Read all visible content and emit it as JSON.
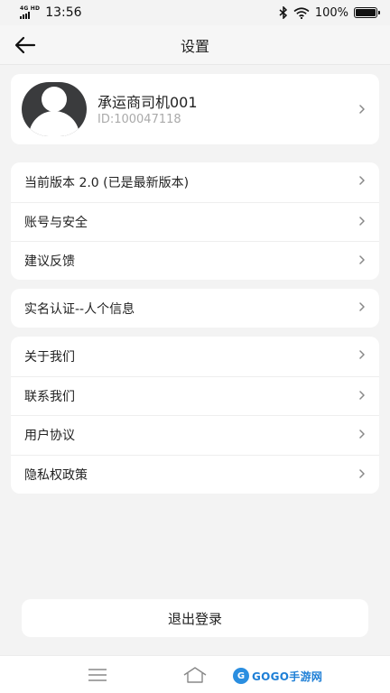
{
  "status_bar": {
    "network_type": "4G HD",
    "time": "13:56",
    "battery_percent": "100%",
    "battery_level": 1.0
  },
  "header": {
    "title": "设置"
  },
  "profile": {
    "name": "承运商司机001",
    "id_text": "ID:100047118"
  },
  "groups": [
    {
      "items": [
        {
          "label": "当前版本 2.0 (已是最新版本)"
        },
        {
          "label": "账号与安全"
        },
        {
          "label": "建议反馈"
        }
      ]
    },
    {
      "items": [
        {
          "label": "实名认证--人个信息"
        }
      ]
    },
    {
      "items": [
        {
          "label": "关于我们"
        },
        {
          "label": "联系我们"
        },
        {
          "label": "用户协议"
        },
        {
          "label": "隐私权政策"
        }
      ]
    }
  ],
  "logout_label": "退出登录",
  "watermark": {
    "logo_letter": "G",
    "text": "GOGO手游网"
  },
  "colors": {
    "page_background": "#f3f3f3",
    "card_background": "#ffffff",
    "secondary_text": "#aaaaaa",
    "watermark_blue": "#1e7fd6"
  }
}
